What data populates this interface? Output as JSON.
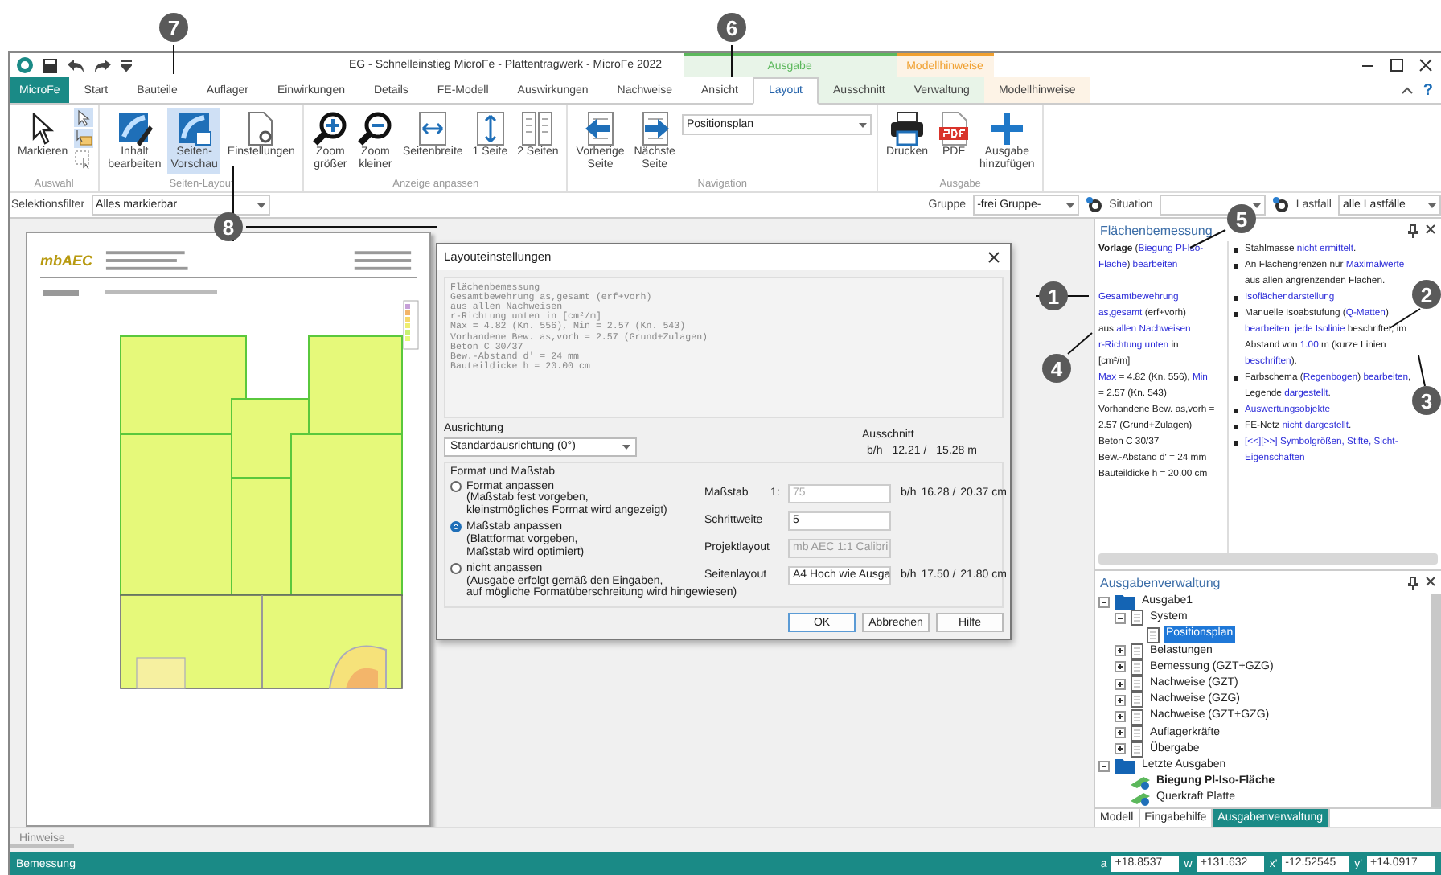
{
  "window": {
    "title": "EG - Schnelleinstieg MicroFe - Plattentragwerk - MicroFe 2022"
  },
  "context_groups": [
    {
      "label": "Ausgabe",
      "color": "#5cb85c"
    },
    {
      "label": "Modellhinweise",
      "color": "#f0a030"
    }
  ],
  "app_tab": "MicroFe",
  "tabs": [
    {
      "label": "Start",
      "selected": false,
      "kind": "standard"
    },
    {
      "label": "Bauteile",
      "selected": false,
      "kind": "standard"
    },
    {
      "label": "Auflager",
      "selected": false,
      "kind": "standard"
    },
    {
      "label": "Einwirkungen",
      "selected": false,
      "kind": "standard"
    },
    {
      "label": "Details",
      "selected": false,
      "kind": "standard"
    },
    {
      "label": "FE-Modell",
      "selected": false,
      "kind": "standard"
    },
    {
      "label": "Auswirkungen",
      "selected": false,
      "kind": "standard"
    },
    {
      "label": "Nachweise",
      "selected": false,
      "kind": "standard"
    },
    {
      "label": "Ansicht",
      "selected": false,
      "kind": "standard"
    },
    {
      "label": "Layout",
      "selected": true,
      "kind": "output"
    },
    {
      "label": "Ausschnitt",
      "selected": false,
      "kind": "output"
    },
    {
      "label": "Verwaltung",
      "selected": false,
      "kind": "output"
    },
    {
      "label": "Modellhinweise",
      "selected": false,
      "kind": "hints"
    }
  ],
  "help": "?",
  "ribbon": {
    "groups": [
      {
        "label": "Auswahl",
        "buttons": [
          {
            "lines": [
              "Markieren"
            ],
            "selected": false
          }
        ]
      },
      {
        "label": "Seiten-Layout",
        "buttons": [
          {
            "lines": [
              "Inhalt",
              "bearbeiten"
            ],
            "selected": false
          },
          {
            "lines": [
              "Seiten-",
              "Vorschau"
            ],
            "selected": true
          },
          {
            "lines": [
              "Einstellungen"
            ],
            "selected": false
          }
        ]
      },
      {
        "label": "Anzeige anpassen",
        "buttons": [
          {
            "lines": [
              "Zoom",
              "größer"
            ],
            "selected": false
          },
          {
            "lines": [
              "Zoom",
              "kleiner"
            ],
            "selected": false
          },
          {
            "lines": [
              "Seitenbreite"
            ],
            "selected": false
          },
          {
            "lines": [
              "1 Seite"
            ],
            "selected": false
          },
          {
            "lines": [
              "2 Seiten"
            ],
            "selected": false
          }
        ]
      },
      {
        "label": "Navigation",
        "buttons": [
          {
            "lines": [
              "Vorherige",
              "Seite"
            ],
            "selected": false
          },
          {
            "lines": [
              "Nächste",
              "Seite"
            ],
            "selected": false
          }
        ],
        "dropdown": "Positionsplan"
      },
      {
        "label": "Ausgabe",
        "buttons": [
          {
            "lines": [
              "Drucken"
            ],
            "selected": false
          },
          {
            "lines": [
              "PDF"
            ],
            "selected": false
          },
          {
            "lines": [
              "Ausgabe",
              "hinzufügen"
            ],
            "selected": false
          }
        ]
      }
    ]
  },
  "filter_bar": {
    "selection_label": "Selektionsfilter",
    "selection_value": "Alles markierbar",
    "group_label": "Gruppe",
    "group_value": "-frei Gruppe-",
    "situation_label": "Situation",
    "loadcase_label": "Lastfall",
    "loadcase_value": "alle Lastfälle"
  },
  "preview": {
    "logo": "mbAEC"
  },
  "dialog": {
    "title": "Layouteinstellungen",
    "preview_lines": [
      "Flächenbemessung",
      "Gesamtbewehrung as,gesamt (erf+vorh)",
      "aus allen Nachweisen",
      "r-Richtung unten in [cm²/m]",
      "Max = 4.82 (Kn. 556), Min = 2.57 (Kn. 543)",
      "Vorhandene Bew. as,vorh = 2.57 (Grund+Zulagen)",
      "Beton C 30/37",
      "Bew.-Abstand d' = 24 mm",
      "Bauteildicke h = 20.00 cm"
    ],
    "orientation_label": "Ausrichtung",
    "orientation_value": "Standardausrichtung (0°)",
    "cutout_label": "Ausschnitt",
    "cutout": {
      "unit_label": "b/h",
      "b": "12.21 /",
      "h": "15.28 m"
    },
    "format_label": "Format und Maßstab",
    "options": [
      {
        "lines": [
          "Format anpassen",
          "(Maßstab fest vorgeben,",
          "kleinstmögliches Format wird angezeigt)"
        ],
        "selected": false
      },
      {
        "lines": [
          "Maßstab anpassen",
          "(Blattformat vorgeben,",
          "Maßstab wird optimiert)"
        ],
        "selected": true
      },
      {
        "lines": [
          "nicht anpassen",
          "(Ausgabe erfolgt gemäß den Eingaben,",
          "auf mögliche Formatüberschreitung wird hingewiesen)"
        ],
        "selected": false
      }
    ],
    "scale_label": "Maßstab",
    "scale_prefix": "1:",
    "scale_value": "75",
    "scale_size": {
      "unit_label": "b/h",
      "b": "16.28 /",
      "h": "20.37 cm"
    },
    "step_label": "Schrittweite",
    "step_value": "5",
    "project_label": "Projektlayout",
    "project_value": "mb AEC 1:1 Calibri",
    "page_label": "Seitenlayout",
    "page_value": "A4 Hoch wie Ausga",
    "page_size": {
      "unit_label": "b/h",
      "b": "17.50 /",
      "h": "21.80 cm"
    },
    "buttons": [
      "OK",
      "Abbrechen",
      "Hilfe"
    ]
  },
  "design_panel": {
    "title": "Flächenbemessung",
    "left_paragraphs": [
      [
        [
          {
            "kind": "bold",
            "text": "Vorlage"
          },
          {
            "kind": "text",
            "text": " ("
          },
          {
            "kind": "link",
            "text": "Biegung Pl-Iso-"
          }
        ],
        [
          {
            "kind": "link",
            "text": "Fläche"
          },
          {
            "kind": "text",
            "text": ") "
          },
          {
            "kind": "link",
            "text": "bearbeiten"
          }
        ]
      ],
      [
        [
          {
            "kind": "link",
            "text": "Gesamtbewehrung"
          }
        ],
        [
          {
            "kind": "link",
            "text": "as,gesamt"
          },
          {
            "kind": "text",
            "text": " (erf+vorh)"
          }
        ],
        [
          {
            "kind": "text",
            "text": "aus "
          },
          {
            "kind": "link",
            "text": "allen Nachweisen"
          }
        ],
        [
          {
            "kind": "link",
            "text": "r-Richtung unten"
          },
          {
            "kind": "text",
            "text": " in"
          }
        ],
        [
          {
            "kind": "text",
            "text": "[cm²/m]"
          }
        ],
        [
          {
            "kind": "link",
            "text": "Max"
          },
          {
            "kind": "text",
            "text": " = 4.82 (Kn. 556), "
          },
          {
            "kind": "link",
            "text": "Min"
          }
        ],
        [
          {
            "kind": "text",
            "text": "= 2.57 (Kn. 543)"
          }
        ],
        [
          {
            "kind": "text",
            "text": "Vorhandene Bew. as,vorh ="
          }
        ],
        [
          {
            "kind": "text",
            "text": "2.57 (Grund+Zulagen)"
          }
        ],
        [
          {
            "kind": "text",
            "text": "Beton C 30/37"
          }
        ],
        [
          {
            "kind": "text",
            "text": "Bew.-Abstand d' = 24 mm"
          }
        ],
        [
          {
            "kind": "text",
            "text": "Bauteildicke h = 20.00 cm"
          }
        ]
      ]
    ],
    "bullets": [
      [
        [
          {
            "kind": "text",
            "text": "Stahlmasse "
          },
          {
            "kind": "link",
            "text": "nicht ermittelt"
          },
          {
            "kind": "text",
            "text": "."
          }
        ]
      ],
      [
        [
          {
            "kind": "text",
            "text": "An Flächengrenzen nur "
          },
          {
            "kind": "link",
            "text": "Maximalwerte"
          }
        ],
        [
          {
            "kind": "text",
            "text": "aus allen angrenzenden Flächen."
          }
        ]
      ],
      [
        [
          {
            "kind": "link",
            "text": "Isoflächendarstellung"
          }
        ]
      ],
      [
        [
          {
            "kind": "text",
            "text": "Manuelle Isoabstufung ("
          },
          {
            "kind": "link",
            "text": "Q-Matten"
          },
          {
            "kind": "text",
            "text": ")"
          }
        ],
        [
          {
            "kind": "link",
            "text": "bearbeiten"
          },
          {
            "kind": "text",
            "text": ", "
          },
          {
            "kind": "link",
            "text": "jede Isolinie"
          },
          {
            "kind": "text",
            "text": " beschriftet, im"
          }
        ],
        [
          {
            "kind": "text",
            "text": "Abstand von "
          },
          {
            "kind": "link",
            "text": "1.00"
          },
          {
            "kind": "text",
            "text": " m (kurze Linien"
          }
        ],
        [
          {
            "kind": "link",
            "text": "beschriften"
          },
          {
            "kind": "text",
            "text": ")."
          }
        ]
      ],
      [
        [
          {
            "kind": "text",
            "text": "Farbschema ("
          },
          {
            "kind": "link",
            "text": "Regenbogen"
          },
          {
            "kind": "text",
            "text": ") "
          },
          {
            "kind": "link",
            "text": "bearbeiten"
          },
          {
            "kind": "text",
            "text": ","
          }
        ],
        [
          {
            "kind": "text",
            "text": "Legende "
          },
          {
            "kind": "link",
            "text": "dargestellt"
          },
          {
            "kind": "text",
            "text": "."
          }
        ]
      ],
      [
        [
          {
            "kind": "link",
            "text": "Auswertungsobjekte"
          }
        ]
      ],
      [
        [
          {
            "kind": "text",
            "text": "FE-Netz "
          },
          {
            "kind": "link",
            "text": "nicht dargestellt"
          },
          {
            "kind": "text",
            "text": "."
          }
        ]
      ],
      [
        [
          {
            "kind": "link",
            "text": "[<<][>>] Symbolgrößen, Stifte, Sicht-"
          }
        ],
        [
          {
            "kind": "link",
            "text": "Eigenschaften"
          }
        ]
      ]
    ]
  },
  "output_panel": {
    "title": "Ausgabenverwaltung",
    "tree": [
      {
        "label": "Ausgabe1",
        "kind": "folder",
        "expanded": true,
        "selected": false,
        "children": [
          {
            "label": "System",
            "kind": "page",
            "expanded": true,
            "selected": false,
            "children": [
              {
                "label": "Positionsplan",
                "kind": "page",
                "selected": true
              }
            ]
          },
          {
            "label": "Belastungen",
            "kind": "page",
            "expanded": false,
            "selected": false
          },
          {
            "label": "Bemessung (GZT+GZG)",
            "kind": "page",
            "expanded": false,
            "selected": false
          },
          {
            "label": "Nachweise (GZT)",
            "kind": "page",
            "expanded": false,
            "selected": false
          },
          {
            "label": "Nachweise (GZG)",
            "kind": "page",
            "expanded": false,
            "selected": false
          },
          {
            "label": "Nachweise (GZT+GZG)",
            "kind": "page",
            "expanded": false,
            "selected": false
          },
          {
            "label": "Auflagerkräfte",
            "kind": "page",
            "expanded": false,
            "selected": false
          },
          {
            "label": "Übergabe",
            "kind": "page",
            "expanded": false,
            "selected": false
          }
        ]
      },
      {
        "label": "Letzte Ausgaben",
        "kind": "folder",
        "expanded": true,
        "selected": false,
        "children": [
          {
            "label": "Biegung Pl-Iso-Fläche",
            "kind": "recent",
            "current": true,
            "selected": false
          },
          {
            "label": "Querkraft Platte",
            "kind": "recent",
            "current": false,
            "selected": false
          }
        ]
      }
    ],
    "tabs": [
      {
        "label": "Modell",
        "selected": false
      },
      {
        "label": "Eingabehilfe",
        "selected": false
      },
      {
        "label": "Ausgabenverwaltung",
        "selected": true
      }
    ]
  },
  "notes_tab": "Hinweise",
  "status_bar": {
    "text": "Bemessung",
    "fields": [
      {
        "label": "a",
        "value": "+18.8537"
      },
      {
        "label": "w",
        "value": "+131.632"
      },
      {
        "label": "x'",
        "value": "-12.52545"
      },
      {
        "label": "y'",
        "value": "+14.0917"
      }
    ]
  },
  "callouts": [
    "7",
    "6",
    "5",
    "1",
    "2",
    "4",
    "3",
    "8"
  ]
}
